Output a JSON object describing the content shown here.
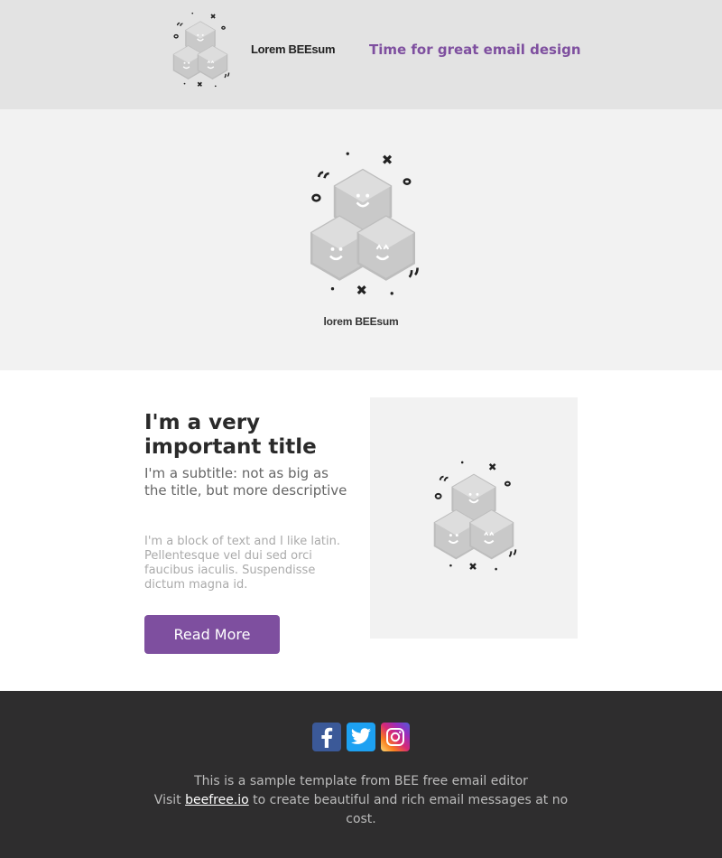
{
  "header": {
    "brand": "Lorem BEEsum",
    "tagline": "Time for great email design"
  },
  "hero": {
    "brand": "lorem BEEsum"
  },
  "content": {
    "title": "I'm a very important title",
    "subtitle": "I'm a subtitle: not as big as the title, but more descriptive",
    "body": "I'm a block of text and I like latin. Pellentesque vel dui sed orci faucibus iaculis. Suspendisse dictum magna id.",
    "button_label": "Read More"
  },
  "footer": {
    "social": [
      "facebook-icon",
      "twitter-icon",
      "instagram-icon"
    ],
    "line1": "This is a sample template from BEE free email editor",
    "visit": "Visit",
    "link": "beefree.io",
    "line2_rest": "to create beautiful and rich email messages at no cost."
  },
  "colors": {
    "accent": "#7e4f9f",
    "header_bg": "#e3e3e3",
    "hero_bg": "#f2f2f2",
    "footer_bg": "#2e2d2e"
  }
}
